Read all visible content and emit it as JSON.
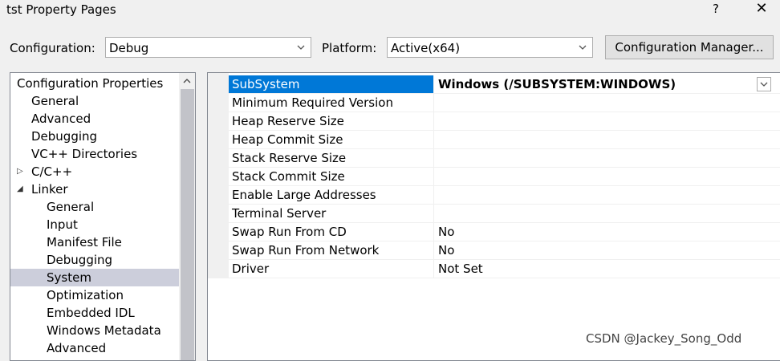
{
  "window": {
    "title": "tst Property Pages",
    "help_glyph": "?",
    "close_glyph": "✕"
  },
  "toolbar": {
    "configuration_label": "Configuration:",
    "configuration_value": "Debug",
    "platform_label": "Platform:",
    "platform_value": "Active(x64)",
    "config_manager_label": "Configuration Manager..."
  },
  "tree": {
    "items": [
      {
        "label": "Configuration Properties",
        "depth": 0,
        "expander": "expanded"
      },
      {
        "label": "General",
        "depth": 1
      },
      {
        "label": "Advanced",
        "depth": 1
      },
      {
        "label": "Debugging",
        "depth": 1
      },
      {
        "label": "VC++ Directories",
        "depth": 1
      },
      {
        "label": "C/C++",
        "depth": 1,
        "expander": "collapsed"
      },
      {
        "label": "Linker",
        "depth": 1,
        "expander": "expanded"
      },
      {
        "label": "General",
        "depth": 2
      },
      {
        "label": "Input",
        "depth": 2
      },
      {
        "label": "Manifest File",
        "depth": 2
      },
      {
        "label": "Debugging",
        "depth": 2
      },
      {
        "label": "System",
        "depth": 2,
        "selected": true
      },
      {
        "label": "Optimization",
        "depth": 2
      },
      {
        "label": "Embedded IDL",
        "depth": 2
      },
      {
        "label": "Windows Metadata",
        "depth": 2
      },
      {
        "label": "Advanced",
        "depth": 2
      }
    ]
  },
  "properties": {
    "rows": [
      {
        "name": "SubSystem",
        "value": "Windows (/SUBSYSTEM:WINDOWS)",
        "selected": true
      },
      {
        "name": "Minimum Required Version",
        "value": ""
      },
      {
        "name": "Heap Reserve Size",
        "value": ""
      },
      {
        "name": "Heap Commit Size",
        "value": ""
      },
      {
        "name": "Stack Reserve Size",
        "value": ""
      },
      {
        "name": "Stack Commit Size",
        "value": ""
      },
      {
        "name": "Enable Large Addresses",
        "value": ""
      },
      {
        "name": "Terminal Server",
        "value": ""
      },
      {
        "name": "Swap Run From CD",
        "value": "No"
      },
      {
        "name": "Swap Run From Network",
        "value": "No"
      },
      {
        "name": "Driver",
        "value": "Not Set"
      }
    ]
  },
  "watermark": "CSDN @Jackey_Song_Odd",
  "colors": {
    "selection_blue": "#0078d7",
    "tree_selection": "#cccedb"
  }
}
